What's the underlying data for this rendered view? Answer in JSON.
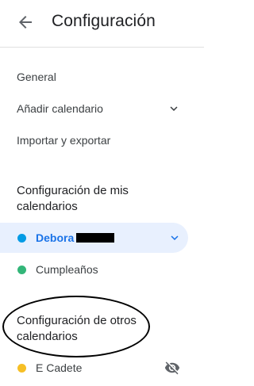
{
  "header": {
    "title": "Configuración",
    "back_icon": "arrow-back-icon"
  },
  "nav": {
    "items": [
      {
        "label": "General"
      },
      {
        "label": "Añadir calendario",
        "icon": "chevron-down-icon"
      },
      {
        "label": "Importar y exportar"
      }
    ]
  },
  "my_calendars": {
    "title_line1": "Configuración de mis",
    "title_line2": "calendarios",
    "items": [
      {
        "label": "Debora",
        "color": "#039be5",
        "selected": true,
        "redacted": true,
        "icon": "chevron-down-icon"
      },
      {
        "label": "Cumpleaños",
        "color": "#33b679"
      }
    ]
  },
  "other_calendars": {
    "title_line1": "Configuración de otros",
    "title_line2": "calendarios",
    "items": [
      {
        "label": "E Cadete",
        "color": "#f6bf26",
        "icon": "visibility-off-icon"
      }
    ]
  },
  "colors": {
    "accent": "#1a73e8",
    "selected_bg": "#e8f0fe"
  }
}
